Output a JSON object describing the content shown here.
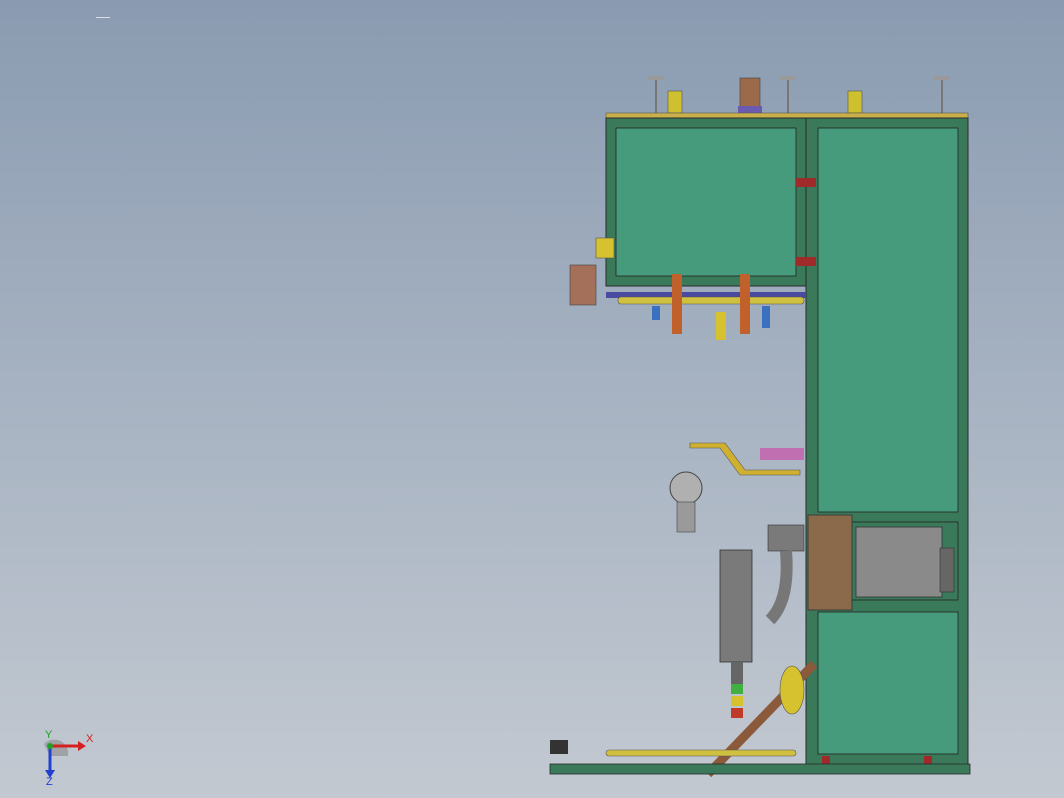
{
  "viewport": {
    "background_top": "#8a9bb1",
    "background_bottom": "#c3c9d1"
  },
  "model": {
    "frame_color": "#3a7a5a",
    "panel_color": "#459b7b",
    "motor_color": "#8a8a8a",
    "bracket_color": "#9a6a4a",
    "accent_yellow": "#d6c22e",
    "accent_red": "#c03a2a"
  },
  "triad": {
    "x_label": "X",
    "y_label": "Y",
    "z_label": "Z",
    "x_color": "#d42020",
    "y_color": "#20a020",
    "z_color": "#2040d0"
  }
}
